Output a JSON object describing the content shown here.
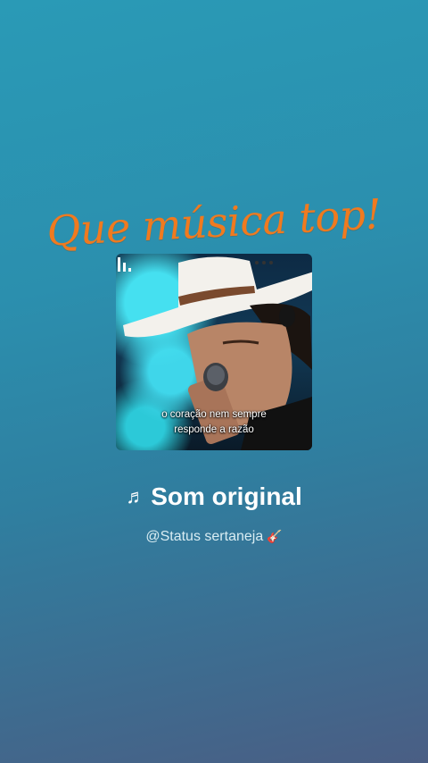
{
  "headline": "Que música top!",
  "cover": {
    "caption_line1": "o coração nem sempre",
    "caption_line2": "responde a razão",
    "logo_icon": "audio-bars-icon"
  },
  "sound": {
    "note_icon": "♬",
    "title": "Som original",
    "author": "@Status sertaneja",
    "author_emoji": "guitar-icon"
  },
  "colors": {
    "background_top": "#2a9ab6",
    "background_bottom": "#4a5e84",
    "headline": "#f07a1f"
  }
}
